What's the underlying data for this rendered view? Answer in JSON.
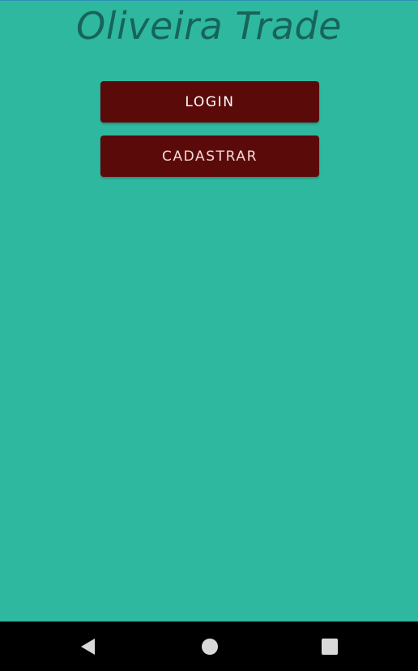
{
  "app": {
    "title": "Oliveira Trade"
  },
  "actions": {
    "login_label": "LOGIN",
    "register_label": "CADASTRAR"
  },
  "navbar": {
    "back_icon": "back-triangle-icon",
    "home_icon": "home-circle-icon",
    "recents_icon": "recents-square-icon"
  },
  "colors": {
    "background": "#2FB8A0",
    "title": "#17655A",
    "button": "#5B0A0A",
    "navbar": "#000000"
  }
}
